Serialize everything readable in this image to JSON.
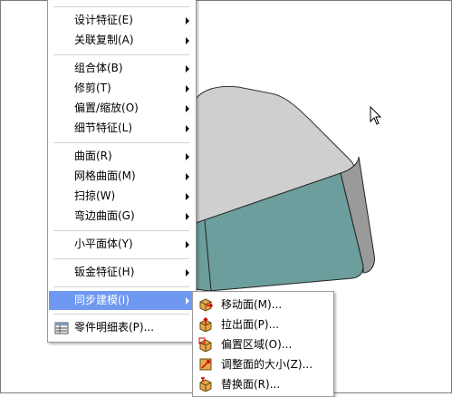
{
  "menu": {
    "items": [
      {
        "label": "设计特征(E)"
      },
      {
        "label": "关联复制(A)"
      },
      {
        "label": "组合体(B)"
      },
      {
        "label": "修剪(T)"
      },
      {
        "label": "偏置/缩放(O)"
      },
      {
        "label": "细节特征(L)"
      },
      {
        "label": "曲面(R)"
      },
      {
        "label": "网格曲面(M)"
      },
      {
        "label": "扫掠(W)"
      },
      {
        "label": "弯边曲面(G)"
      },
      {
        "label": "小平面体(Y)"
      },
      {
        "label": "钣金特征(H)"
      },
      {
        "label": "同步建模(I)"
      },
      {
        "label": "零件明细表(P)..."
      }
    ]
  },
  "submenu": {
    "items": [
      {
        "label": "移动面(M)...",
        "icon": "move-face-icon"
      },
      {
        "label": "拉出面(P)...",
        "icon": "pull-face-icon"
      },
      {
        "label": "偏置区域(O)...",
        "icon": "offset-region-icon"
      },
      {
        "label": "调整面的大小(Z)...",
        "icon": "resize-face-icon"
      },
      {
        "label": "替换面(R)...",
        "icon": "replace-face-icon"
      }
    ]
  },
  "colors": {
    "highlight": "#6f98f0",
    "model_top": "#cfcfcf",
    "model_front": "#6b9e9c",
    "model_side": "#9a9a9a"
  }
}
